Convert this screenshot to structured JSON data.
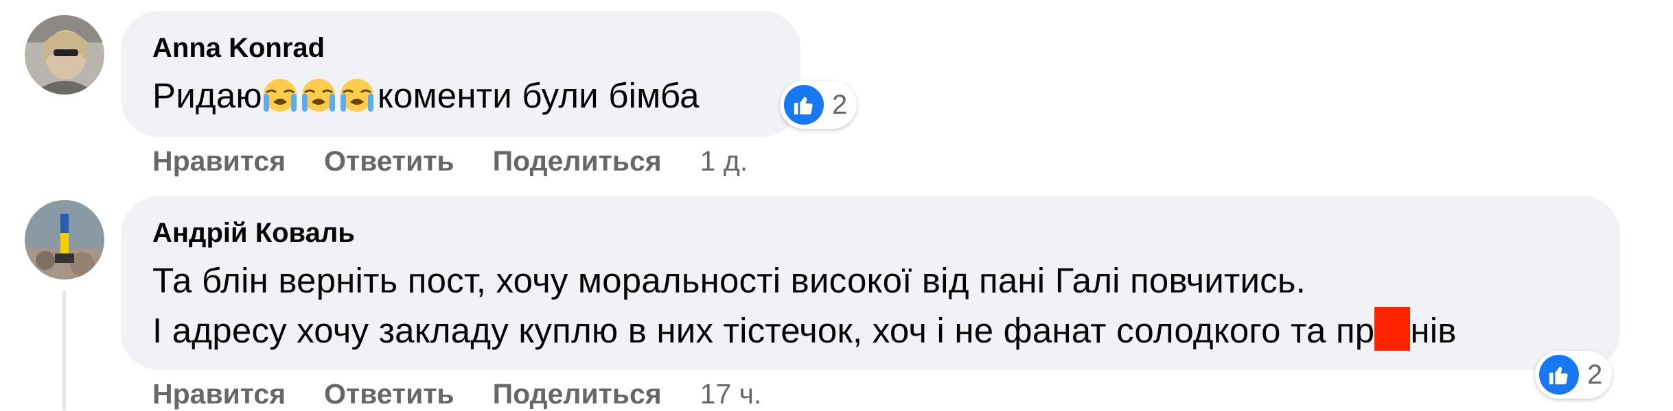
{
  "comments": [
    {
      "author": "Anna Konrad",
      "text_before_emoji": "Ридаю",
      "text_after_emoji": "коменти були бімба",
      "emoji": [
        "loudly-crying-face",
        "loudly-crying-face",
        "loudly-crying-face"
      ],
      "reaction_icon": "like-icon",
      "reaction_count": "2",
      "actions": {
        "like": "Нравится",
        "reply": "Ответить",
        "share": "Поделиться"
      },
      "time": "1 д."
    },
    {
      "author": "Андрій Коваль",
      "line1": "Та блін верніть пост, хочу моральності високої від пані Галі повчитись.",
      "line2_before": "І адресу хочу закладу куплю в них тістечок, хоч і не фанат солодкого та пр",
      "line2_after": "нів",
      "reaction_icon": "like-icon",
      "reaction_count": "2",
      "actions": {
        "like": "Нравится",
        "reply": "Ответить",
        "share": "Поделиться"
      },
      "time": "17 ч."
    }
  ],
  "colors": {
    "bubble": "#f0f2f5",
    "text": "#050505",
    "secondary": "#65676b",
    "like_blue": "#1877f2",
    "redaction": "#ff2400"
  }
}
